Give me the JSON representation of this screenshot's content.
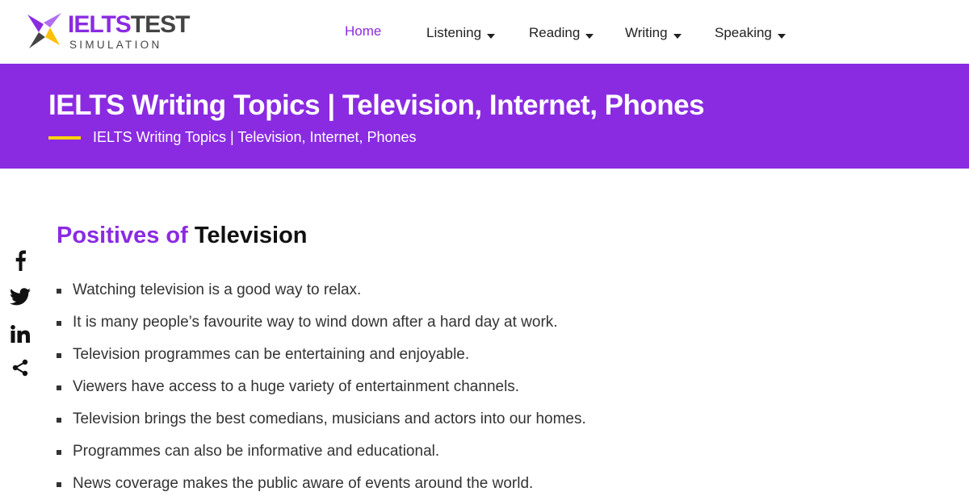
{
  "logo": {
    "part1": "IELTS",
    "part2": "TEST",
    "subtitle": "SIMULATION"
  },
  "nav": {
    "items": [
      {
        "label": "Home",
        "active": true,
        "dropdown": false
      },
      {
        "label": "Listening",
        "active": false,
        "dropdown": true
      },
      {
        "label": "Reading",
        "active": false,
        "dropdown": true
      },
      {
        "label": "Writing",
        "active": false,
        "dropdown": true
      },
      {
        "label": "Speaking",
        "active": false,
        "dropdown": true
      }
    ]
  },
  "banner": {
    "title": "IELTS Writing Topics | Television, Internet, Phones",
    "breadcrumb": "IELTS Writing Topics | Television, Internet, Phones"
  },
  "share": {
    "icons": [
      "facebook-icon",
      "twitter-icon",
      "linkedin-icon",
      "share-icon"
    ]
  },
  "section": {
    "title_prefix": "Positives of ",
    "title_highlight": "Television",
    "bullets": [
      "Watching television is a good way to relax.",
      "It is many people’s favourite way to wind down after a hard day at work.",
      "Television programmes can be entertaining and enjoyable.",
      "Viewers have access to a huge variety of entertainment channels.",
      "Television brings the best comedians, musicians and actors into our homes.",
      "Programmes can also be informative and educational.",
      "News coverage makes the public aware of events around the world."
    ]
  },
  "colors": {
    "brand_purple": "#8a2be2",
    "accent_yellow": "#ffd400",
    "text_dark": "#333333"
  }
}
